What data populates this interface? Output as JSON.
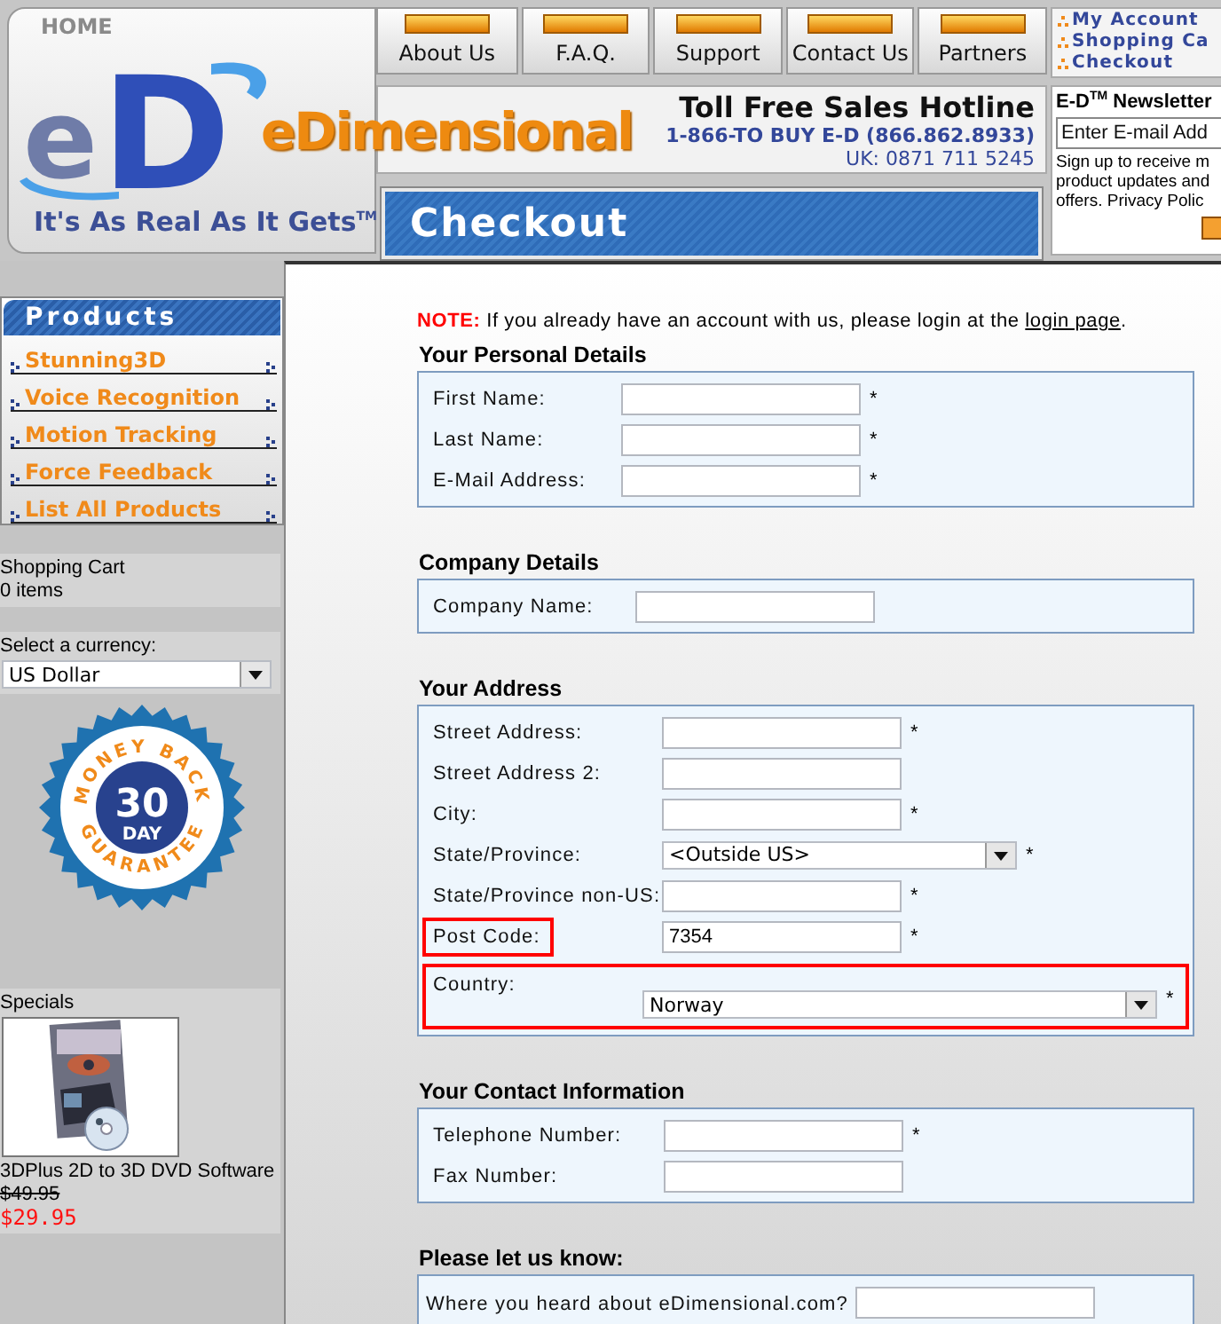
{
  "header": {
    "home": "HOME",
    "logo_mark": [
      "e",
      "D"
    ],
    "logo_text": "eDimensional",
    "tagline": "It's As Real As It Gets$^{TM}$",
    "nav": [
      {
        "label": "About Us"
      },
      {
        "label": "F.A.Q."
      },
      {
        "label": "Support"
      },
      {
        "label": "Contact Us"
      },
      {
        "label": "Partners"
      }
    ],
    "hotline": {
      "title": "Toll Free Sales Hotline",
      "lines": [
        "1-866-TO BUY E-D (866.862.8933)",
        "UK: 0871 711 5245"
      ]
    },
    "page_title": "Checkout",
    "account_links": [
      "My Account",
      "Shopping Ca",
      "Checkout"
    ],
    "newsletter": {
      "title": "E-D$^{TM}$ Newsletter",
      "placeholder": "Enter E-mail Add",
      "lines": [
        "Sign up to receive m",
        "product updates and",
        "offers. Privacy Polic"
      ]
    }
  },
  "sidebar": {
    "products_title": "Products",
    "products": [
      "Stunning3D",
      "Voice Recognition",
      "Motion Tracking",
      "Force Feedback",
      "List All Products"
    ],
    "cart": {
      "title": "Shopping Cart",
      "count": "0 items"
    },
    "currency": {
      "label": "Select a currency:",
      "value": "US Dollar"
    },
    "badge": {
      "top": "MONEY BACK",
      "number": "30",
      "unit": "DAY",
      "bottom": "GUARANTEE"
    },
    "specials": {
      "title": "Specials",
      "name": "3DPlus 2D to 3D DVD Software",
      "old_price": "$49.95",
      "price": "$29.95"
    }
  },
  "note": {
    "label": "NOTE:",
    "text": "If you already have an account with us, please login at the",
    "link": "login page",
    "end": "."
  },
  "sections": [
    {
      "title": "Your Personal Details",
      "rows": [
        {
          "kind": "text",
          "label": "First Name:",
          "marker": "*"
        },
        {
          "kind": "text",
          "label": "Last Name:",
          "marker": "*"
        },
        {
          "kind": "text",
          "label": "E-Mail Address:",
          "marker": "*"
        }
      ]
    },
    {
      "title": "Company Details",
      "rows": [
        {
          "kind": "text",
          "label": "Company Name:"
        }
      ]
    },
    {
      "title": "Your Address",
      "rows": [
        {
          "kind": "text",
          "label": "Street Address:",
          "marker": "*"
        },
        {
          "kind": "text",
          "label": "Street Address 2:"
        },
        {
          "kind": "text",
          "label": "City:",
          "marker": "*"
        },
        {
          "kind": "select",
          "label": "State/Province:",
          "value": "<Outside US>",
          "marker": "*"
        },
        {
          "kind": "text",
          "label": "State/Province non-US:",
          "marker": "*"
        },
        {
          "kind": "text",
          "label": "Post Code:",
          "value": "7354",
          "marker": "*",
          "label_highlighted": true
        },
        {
          "kind": "select",
          "label": "Country:",
          "value": "Norway",
          "marker": "*",
          "row_highlighted": true
        }
      ]
    },
    {
      "title": "Your Contact Information",
      "rows": [
        {
          "kind": "text",
          "label": "Telephone Number:",
          "marker": "*"
        },
        {
          "kind": "text",
          "label": "Fax Number:"
        }
      ]
    },
    {
      "title": "Please let us know:",
      "rows": [
        {
          "kind": "text",
          "label": "Where you heard about eDimensional.com?"
        }
      ]
    }
  ]
}
